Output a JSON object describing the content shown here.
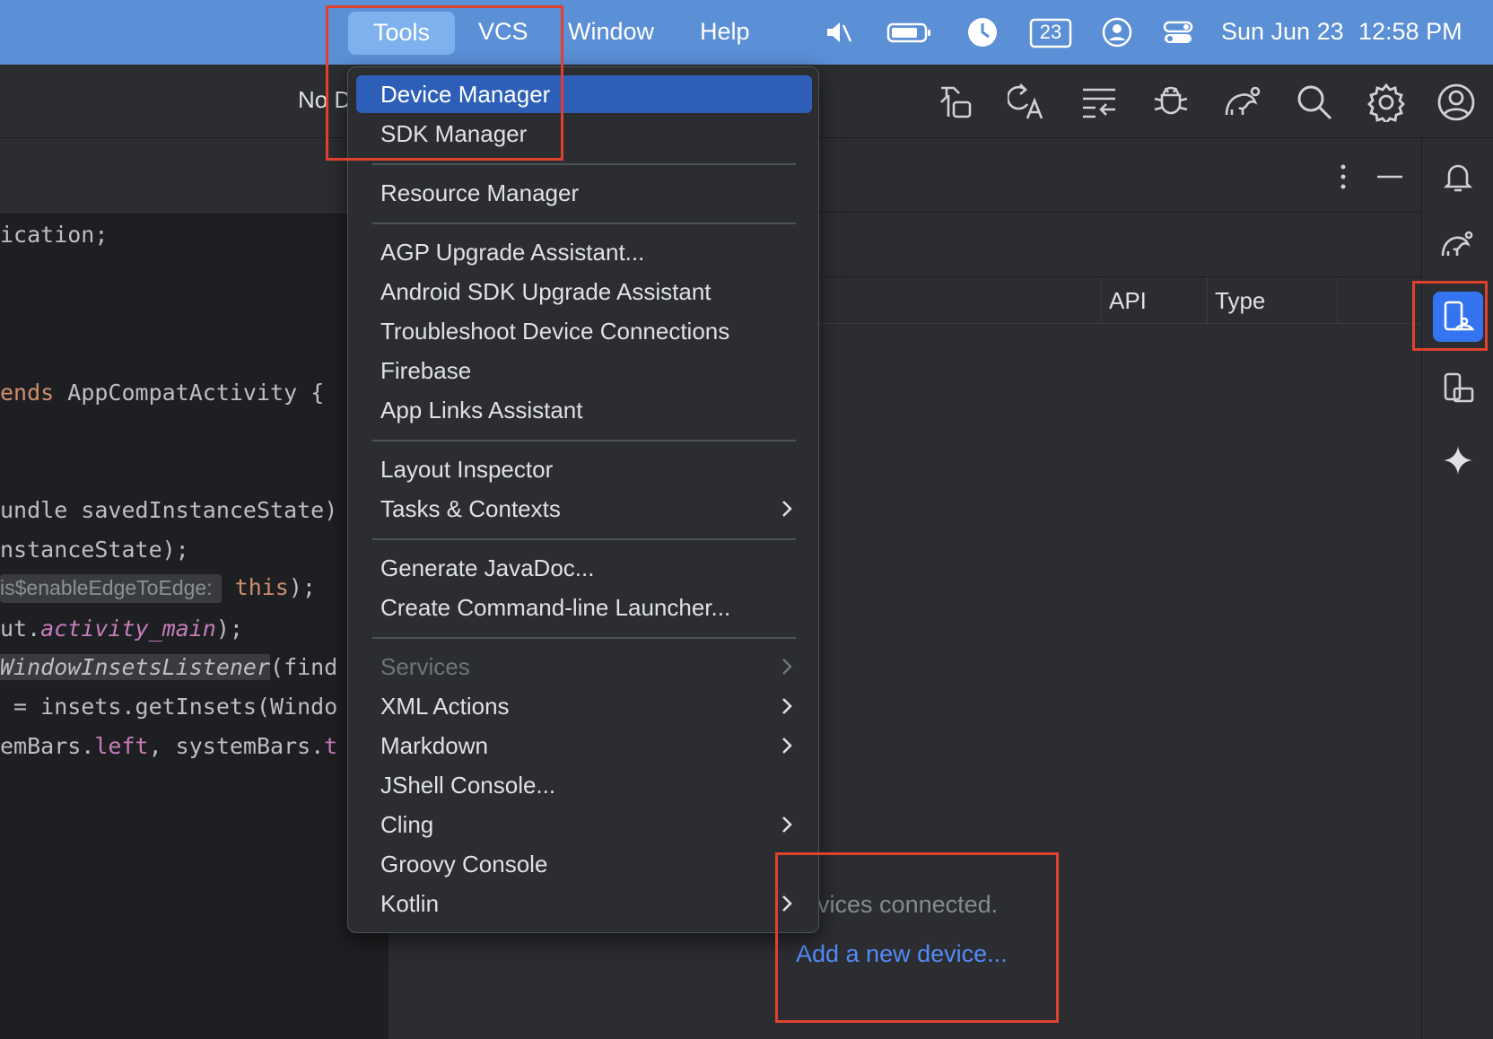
{
  "menubar": {
    "items": [
      "Tools",
      "VCS",
      "Window",
      "Help"
    ],
    "badge_number": "23",
    "date": "Sun Jun 23",
    "time": "12:58 PM"
  },
  "toolbar": {
    "device_label": "No D",
    "icons": [
      "build-icon",
      "translate-icon",
      "logcat-icon",
      "debug-icon",
      "gradle-icon",
      "search-icon",
      "settings-icon",
      "account-icon"
    ]
  },
  "editor": {
    "lines": {
      "l1": "ication;",
      "l2_kw": "ends",
      "l2_rest": " AppCompatActivity {",
      "l3": "undle savedInstanceState)",
      "l4": "nstanceState);",
      "l5_hint": "is$enableEdgeToEdge:",
      "l5_kw": "this",
      "l5_rest": ");",
      "l6_a": "ut.",
      "l6_field": "activity_main",
      "l6_b": ");",
      "l7_fn": "WindowInsetsListener",
      "l7_rest": "(find",
      "l8": " = insets.getInsets(Windo",
      "l9_a": "emBars.",
      "l9_field": "left",
      "l9_b": ", systemBars.",
      "l9_c": "t"
    }
  },
  "panel": {
    "columns": [
      "API",
      "Type"
    ],
    "empty_text": "devices connected.",
    "add_link": "Add a new device..."
  },
  "menu": {
    "items": [
      {
        "label": "Device Manager",
        "selected": true
      },
      {
        "label": "SDK Manager"
      },
      {
        "label": "Resource Manager"
      },
      {
        "label": "AGP Upgrade Assistant..."
      },
      {
        "label": "Android SDK Upgrade Assistant"
      },
      {
        "label": "Troubleshoot Device Connections"
      },
      {
        "label": "Firebase"
      },
      {
        "label": "App Links Assistant"
      },
      {
        "label": "Layout Inspector"
      },
      {
        "label": "Tasks & Contexts",
        "submenu": true
      },
      {
        "label": "Generate JavaDoc..."
      },
      {
        "label": "Create Command-line Launcher..."
      },
      {
        "label": "Services",
        "submenu": true,
        "disabled": true
      },
      {
        "label": "XML Actions",
        "submenu": true
      },
      {
        "label": "Markdown",
        "submenu": true
      },
      {
        "label": "JShell Console..."
      },
      {
        "label": "Cling",
        "submenu": true
      },
      {
        "label": "Groovy Console"
      },
      {
        "label": "Kotlin",
        "submenu": true
      }
    ]
  },
  "colors": {
    "menubar_bg": "#5b8fd6",
    "selection": "#2e5fb8",
    "accent_blue": "#3574f0",
    "annotation_red": "#e0412f",
    "link_blue": "#548af7"
  }
}
